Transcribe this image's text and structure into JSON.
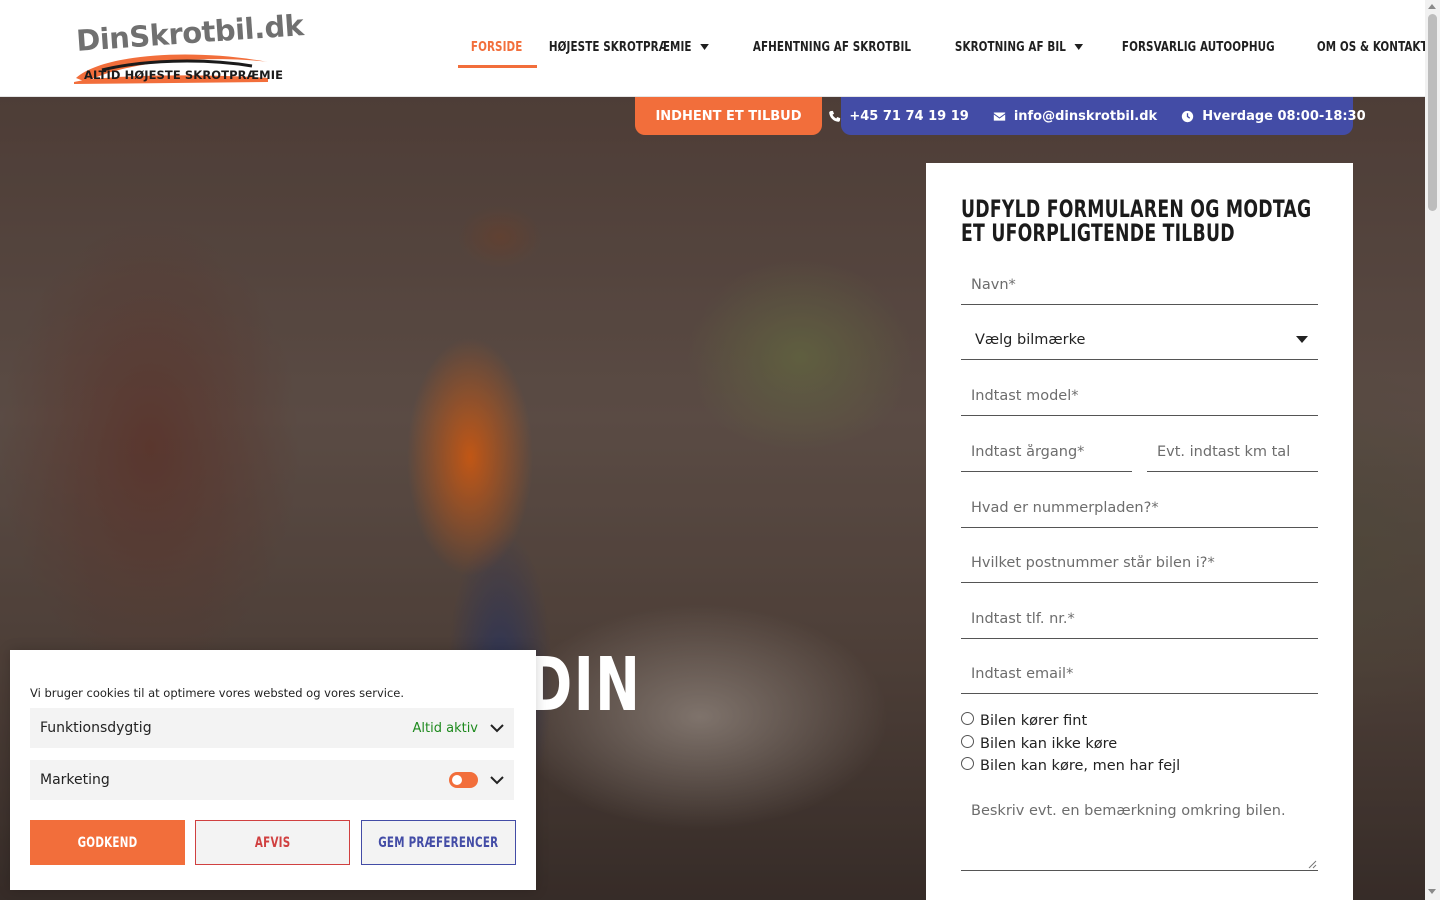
{
  "logo": {
    "wordmark": "DinSkrotbil.dk",
    "tagline": "ALTID HØJESTE SKROTPRÆMIE"
  },
  "nav": {
    "items": [
      {
        "label": "FORSIDE",
        "active": true,
        "dropdown": false
      },
      {
        "label": "HØJESTE SKROTPRÆMIE",
        "active": false,
        "dropdown": true
      },
      {
        "label": "AFHENTNING AF SKROTBIL",
        "active": false,
        "dropdown": false
      },
      {
        "label": "SKROTNING AF BIL",
        "active": false,
        "dropdown": true
      },
      {
        "label": "FORSVARLIG AUTOOPHUG",
        "active": false,
        "dropdown": false
      },
      {
        "label": "OM OS & KONTAKT",
        "active": false,
        "dropdown": false
      }
    ]
  },
  "topbar": {
    "cta_label": "INDHENT ET TILBUD",
    "phone": "+45 71 74 19 19",
    "email": "info@dinskrotbil.dk",
    "hours": "Hverdage 08:00-18:30"
  },
  "hero": {
    "title_fragment": "DIN"
  },
  "form": {
    "title": "UDFYLD FORMULAREN OG MODTAG ET UFORPLIGTENDE TILBUD",
    "name_placeholder": "Navn*",
    "brand_select_value": "Vælg bilmærke",
    "model_placeholder": "Indtast model*",
    "year_placeholder": "Indtast årgang*",
    "km_placeholder": "Evt. indtast km tal",
    "plate_placeholder": "Hvad er nummerpladen?*",
    "zip_placeholder": "Hvilket postnummer står bilen i?*",
    "phone_placeholder": "Indtast tlf. nr.*",
    "email_placeholder": "Indtast email*",
    "radio_options": [
      "Bilen kører fint",
      "Bilen kan ikke køre",
      "Bilen kan køre, men har fejl"
    ],
    "remark_placeholder": "Beskriv evt. en bemærkning omkring bilen."
  },
  "cookie": {
    "text": "Vi bruger cookies til at optimere vores websted og vores service.",
    "functional_label": "Funktionsdygtig",
    "functional_status": "Altid aktiv",
    "marketing_label": "Marketing",
    "accept_label": "GODKEND",
    "deny_label": "AFVIS",
    "save_label": "GEM PRÆFERENCER"
  },
  "colors": {
    "accent_orange": "#f26e3b",
    "accent_blue": "#434ca6",
    "always_active_green": "#1e8a1e"
  }
}
